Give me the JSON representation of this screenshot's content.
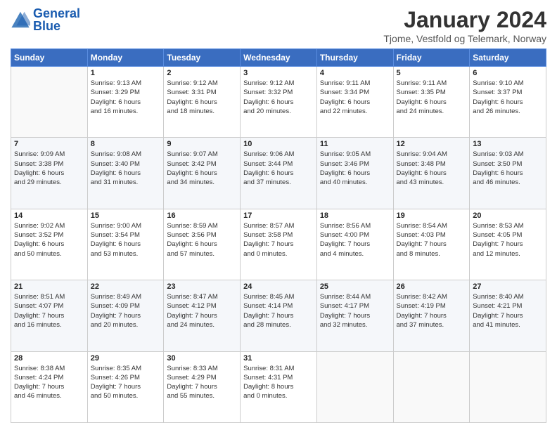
{
  "logo": {
    "line1": "General",
    "line2": "Blue"
  },
  "title": "January 2024",
  "location": "Tjome, Vestfold og Telemark, Norway",
  "days_of_week": [
    "Sunday",
    "Monday",
    "Tuesday",
    "Wednesday",
    "Thursday",
    "Friday",
    "Saturday"
  ],
  "weeks": [
    [
      {
        "day": "",
        "info": ""
      },
      {
        "day": "1",
        "info": "Sunrise: 9:13 AM\nSunset: 3:29 PM\nDaylight: 6 hours\nand 16 minutes."
      },
      {
        "day": "2",
        "info": "Sunrise: 9:12 AM\nSunset: 3:31 PM\nDaylight: 6 hours\nand 18 minutes."
      },
      {
        "day": "3",
        "info": "Sunrise: 9:12 AM\nSunset: 3:32 PM\nDaylight: 6 hours\nand 20 minutes."
      },
      {
        "day": "4",
        "info": "Sunrise: 9:11 AM\nSunset: 3:34 PM\nDaylight: 6 hours\nand 22 minutes."
      },
      {
        "day": "5",
        "info": "Sunrise: 9:11 AM\nSunset: 3:35 PM\nDaylight: 6 hours\nand 24 minutes."
      },
      {
        "day": "6",
        "info": "Sunrise: 9:10 AM\nSunset: 3:37 PM\nDaylight: 6 hours\nand 26 minutes."
      }
    ],
    [
      {
        "day": "7",
        "info": "Sunrise: 9:09 AM\nSunset: 3:38 PM\nDaylight: 6 hours\nand 29 minutes."
      },
      {
        "day": "8",
        "info": "Sunrise: 9:08 AM\nSunset: 3:40 PM\nDaylight: 6 hours\nand 31 minutes."
      },
      {
        "day": "9",
        "info": "Sunrise: 9:07 AM\nSunset: 3:42 PM\nDaylight: 6 hours\nand 34 minutes."
      },
      {
        "day": "10",
        "info": "Sunrise: 9:06 AM\nSunset: 3:44 PM\nDaylight: 6 hours\nand 37 minutes."
      },
      {
        "day": "11",
        "info": "Sunrise: 9:05 AM\nSunset: 3:46 PM\nDaylight: 6 hours\nand 40 minutes."
      },
      {
        "day": "12",
        "info": "Sunrise: 9:04 AM\nSunset: 3:48 PM\nDaylight: 6 hours\nand 43 minutes."
      },
      {
        "day": "13",
        "info": "Sunrise: 9:03 AM\nSunset: 3:50 PM\nDaylight: 6 hours\nand 46 minutes."
      }
    ],
    [
      {
        "day": "14",
        "info": "Sunrise: 9:02 AM\nSunset: 3:52 PM\nDaylight: 6 hours\nand 50 minutes."
      },
      {
        "day": "15",
        "info": "Sunrise: 9:00 AM\nSunset: 3:54 PM\nDaylight: 6 hours\nand 53 minutes."
      },
      {
        "day": "16",
        "info": "Sunrise: 8:59 AM\nSunset: 3:56 PM\nDaylight: 6 hours\nand 57 minutes."
      },
      {
        "day": "17",
        "info": "Sunrise: 8:57 AM\nSunset: 3:58 PM\nDaylight: 7 hours\nand 0 minutes."
      },
      {
        "day": "18",
        "info": "Sunrise: 8:56 AM\nSunset: 4:00 PM\nDaylight: 7 hours\nand 4 minutes."
      },
      {
        "day": "19",
        "info": "Sunrise: 8:54 AM\nSunset: 4:03 PM\nDaylight: 7 hours\nand 8 minutes."
      },
      {
        "day": "20",
        "info": "Sunrise: 8:53 AM\nSunset: 4:05 PM\nDaylight: 7 hours\nand 12 minutes."
      }
    ],
    [
      {
        "day": "21",
        "info": "Sunrise: 8:51 AM\nSunset: 4:07 PM\nDaylight: 7 hours\nand 16 minutes."
      },
      {
        "day": "22",
        "info": "Sunrise: 8:49 AM\nSunset: 4:09 PM\nDaylight: 7 hours\nand 20 minutes."
      },
      {
        "day": "23",
        "info": "Sunrise: 8:47 AM\nSunset: 4:12 PM\nDaylight: 7 hours\nand 24 minutes."
      },
      {
        "day": "24",
        "info": "Sunrise: 8:45 AM\nSunset: 4:14 PM\nDaylight: 7 hours\nand 28 minutes."
      },
      {
        "day": "25",
        "info": "Sunrise: 8:44 AM\nSunset: 4:17 PM\nDaylight: 7 hours\nand 32 minutes."
      },
      {
        "day": "26",
        "info": "Sunrise: 8:42 AM\nSunset: 4:19 PM\nDaylight: 7 hours\nand 37 minutes."
      },
      {
        "day": "27",
        "info": "Sunrise: 8:40 AM\nSunset: 4:21 PM\nDaylight: 7 hours\nand 41 minutes."
      }
    ],
    [
      {
        "day": "28",
        "info": "Sunrise: 8:38 AM\nSunset: 4:24 PM\nDaylight: 7 hours\nand 46 minutes."
      },
      {
        "day": "29",
        "info": "Sunrise: 8:35 AM\nSunset: 4:26 PM\nDaylight: 7 hours\nand 50 minutes."
      },
      {
        "day": "30",
        "info": "Sunrise: 8:33 AM\nSunset: 4:29 PM\nDaylight: 7 hours\nand 55 minutes."
      },
      {
        "day": "31",
        "info": "Sunrise: 8:31 AM\nSunset: 4:31 PM\nDaylight: 8 hours\nand 0 minutes."
      },
      {
        "day": "",
        "info": ""
      },
      {
        "day": "",
        "info": ""
      },
      {
        "day": "",
        "info": ""
      }
    ]
  ]
}
